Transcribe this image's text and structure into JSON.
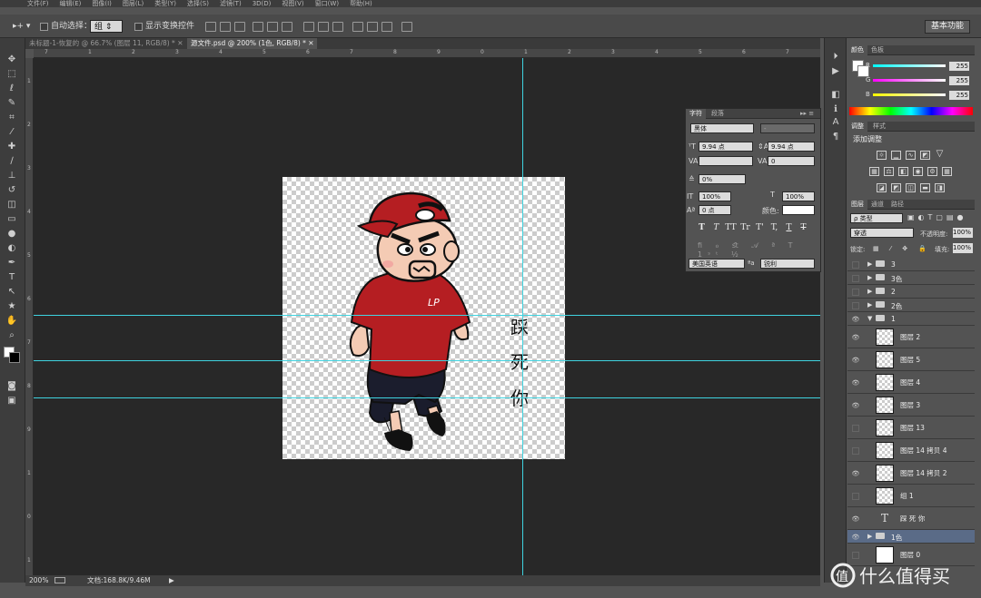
{
  "menubar": {
    "items": [
      "文件(F)",
      "编辑(E)",
      "图像(I)",
      "图层(L)",
      "类型(Y)",
      "选择(S)",
      "滤镜(T)",
      "3D(D)",
      "视图(V)",
      "窗口(W)",
      "帮助(H)"
    ]
  },
  "options_bar": {
    "auto_select_label": "自动选择：",
    "auto_select_value": "组",
    "show_transform_label": "显示变换控件",
    "workspace_button": "基本功能"
  },
  "tabs": [
    {
      "label": "未标题-1-恢复的 @ 66.7% (图层 11, RGB/8) *",
      "active": false
    },
    {
      "label": "源文件.psd @ 200% (1色, RGB/8) *",
      "active": true
    }
  ],
  "ruler_top_marks": [
    "7",
    "1",
    "2",
    "3",
    "4",
    "5",
    "6",
    "7",
    "8",
    "9",
    "0",
    "1",
    "2",
    "3",
    "4",
    "5",
    "6",
    "7"
  ],
  "ruler_left_marks": [
    "1",
    "2",
    "3",
    "4",
    "5",
    "6",
    "7",
    "8",
    "9",
    "1",
    "0",
    "1"
  ],
  "canvas": {
    "artwork_text": [
      "踩",
      "死",
      "你"
    ],
    "shirt_logo": "LP"
  },
  "statusbar": {
    "zoom": "200%",
    "doc_info": "文档:168.8K/9.46M"
  },
  "color_panel": {
    "tabs": [
      "颜色",
      "色板"
    ],
    "channels": [
      {
        "label": "R",
        "value": "255",
        "color": "#ff3b3b"
      },
      {
        "label": "G",
        "value": "255",
        "color": "#45e05a"
      },
      {
        "label": "B",
        "value": "255",
        "color": "#3a6bff"
      }
    ]
  },
  "adjustments_panel": {
    "tabs": [
      "调整",
      "样式"
    ],
    "title": "添加调整"
  },
  "layers_panel": {
    "tabs": [
      "图层",
      "通道",
      "路径"
    ],
    "filter_label": "ρ 类型",
    "blend_mode": "穿透",
    "opacity_label": "不透明度:",
    "opacity_value": "100%",
    "lock_label": "锁定:",
    "fill_label": "填充:",
    "fill_value": "100%",
    "layers": [
      {
        "name": "3",
        "type": "group",
        "visible": false,
        "indent": 0,
        "selected": false
      },
      {
        "name": "3色",
        "type": "group",
        "visible": false,
        "indent": 0,
        "selected": false
      },
      {
        "name": "2",
        "type": "group",
        "visible": false,
        "indent": 0,
        "selected": false
      },
      {
        "name": "2色",
        "type": "group",
        "visible": false,
        "indent": 0,
        "selected": false
      },
      {
        "name": "1",
        "type": "group-open",
        "visible": true,
        "indent": 0,
        "selected": false
      },
      {
        "name": "图层 2",
        "type": "layer",
        "visible": true,
        "indent": 1,
        "selected": false
      },
      {
        "name": "图层 5",
        "type": "layer",
        "visible": true,
        "indent": 1,
        "selected": false
      },
      {
        "name": "图层 4",
        "type": "layer",
        "visible": true,
        "indent": 1,
        "selected": false
      },
      {
        "name": "图层 3",
        "type": "layer",
        "visible": true,
        "indent": 1,
        "selected": false
      },
      {
        "name": "图层 13",
        "type": "layer",
        "visible": false,
        "indent": 1,
        "selected": false
      },
      {
        "name": "图层 14 拷贝 4",
        "type": "layer",
        "visible": false,
        "indent": 1,
        "selected": false
      },
      {
        "name": "图层 14 拷贝 2",
        "type": "layer",
        "visible": true,
        "indent": 1,
        "selected": false
      },
      {
        "name": "组 1",
        "type": "layer",
        "visible": false,
        "indent": 1,
        "selected": false
      },
      {
        "name": "踩 死 你",
        "type": "text",
        "visible": true,
        "indent": 1,
        "selected": false
      },
      {
        "name": "1色",
        "type": "group",
        "visible": true,
        "indent": 0,
        "selected": true
      },
      {
        "name": "图层 0",
        "type": "layer-white",
        "visible": false,
        "indent": 0,
        "selected": false
      }
    ]
  },
  "character_panel": {
    "tabs": [
      "字符",
      "段落"
    ],
    "font_family": "黑体",
    "font_style": "-",
    "font_size": "9.94 点",
    "leading": "9.94 点",
    "kerning": "",
    "tracking": "0",
    "vertical_scale_pct": "0%",
    "scale_v": "100%",
    "scale_h": "100%",
    "baseline_shift": "0 点",
    "color_label": "颜色:",
    "language": "美国英语",
    "antialias_label": "ªa",
    "antialias": "锐利",
    "style_buttons": [
      "T",
      "T",
      "TT",
      "Tr",
      "T'",
      "T,",
      "T",
      "T"
    ]
  },
  "watermark": {
    "text": "什么值得买"
  }
}
